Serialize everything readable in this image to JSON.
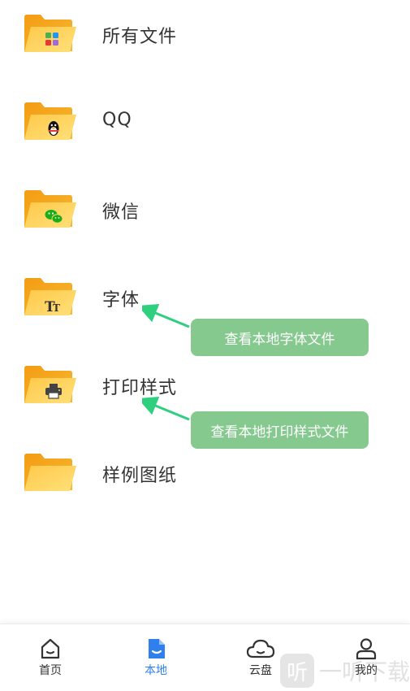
{
  "folders": [
    {
      "label": "所有文件",
      "icon": "apps-grid-icon"
    },
    {
      "label": "QQ",
      "icon": "qq-penguin-icon"
    },
    {
      "label": "微信",
      "icon": "wechat-icon"
    },
    {
      "label": "字体",
      "icon": "font-tt-icon"
    },
    {
      "label": "打印样式",
      "icon": "printer-icon"
    },
    {
      "label": "样例图纸",
      "icon": "folder-icon"
    }
  ],
  "callouts": {
    "fonts": "查看本地字体文件",
    "print_styles": "查看本地打印样式文件"
  },
  "nav": {
    "items": [
      {
        "label": "首页",
        "icon": "home-icon"
      },
      {
        "label": "本地",
        "icon": "local-file-icon"
      },
      {
        "label": "云盘",
        "icon": "cloud-icon"
      },
      {
        "label": "我的",
        "icon": "user-icon"
      }
    ],
    "active_index": 1
  },
  "watermark": {
    "badge": "听",
    "text": "一听下载"
  },
  "colors": {
    "folder_back": "#f5a623",
    "folder_front": "#ffd65c",
    "callout_bg": "#85c98f",
    "arrow": "#2ecf7f",
    "active": "#2f80ed"
  }
}
